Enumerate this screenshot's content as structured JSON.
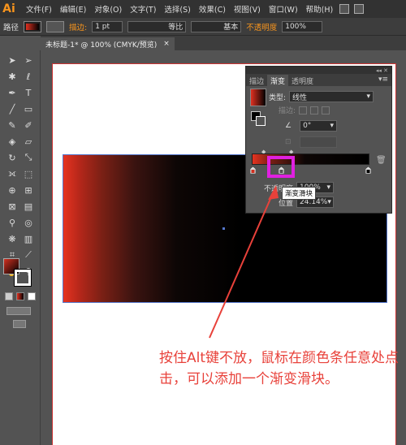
{
  "app": {
    "logo": "Ai"
  },
  "menu": [
    "文件(F)",
    "编辑(E)",
    "对象(O)",
    "文字(T)",
    "选择(S)",
    "效果(C)",
    "视图(V)",
    "窗口(W)",
    "帮助(H)"
  ],
  "control_bar": {
    "selection_label": "路径",
    "stroke_label": "描边:",
    "stroke_value": "1 pt",
    "profile_label": "等比",
    "brush_label": "基本",
    "opacity_label": "不透明度",
    "opacity_value": "100%"
  },
  "document_tab": {
    "title": "未标题-1* @ 100% (CMYK/预览)",
    "close": "×"
  },
  "gradient_panel": {
    "tabs": [
      "描边",
      "渐变",
      "透明度"
    ],
    "active_tab": "渐变",
    "type_label": "类型:",
    "type_value": "线性",
    "stroke_label": "描边:",
    "angle_value": "0°",
    "opacity_label": "不透明度",
    "opacity_value": "100%",
    "location_label": "位置",
    "location_value": "24.14%"
  },
  "tooltip": "渐变滑块",
  "annotation": "按住Alt键不放，鼠标在颜色条任意处点击，可以添加一个渐变滑块。",
  "colors": {
    "accent_orange": "#f7941d",
    "highlight": "#e020e0",
    "annotation_red": "#e8413a",
    "gradient_start": "#e63320",
    "gradient_end": "#000000"
  }
}
